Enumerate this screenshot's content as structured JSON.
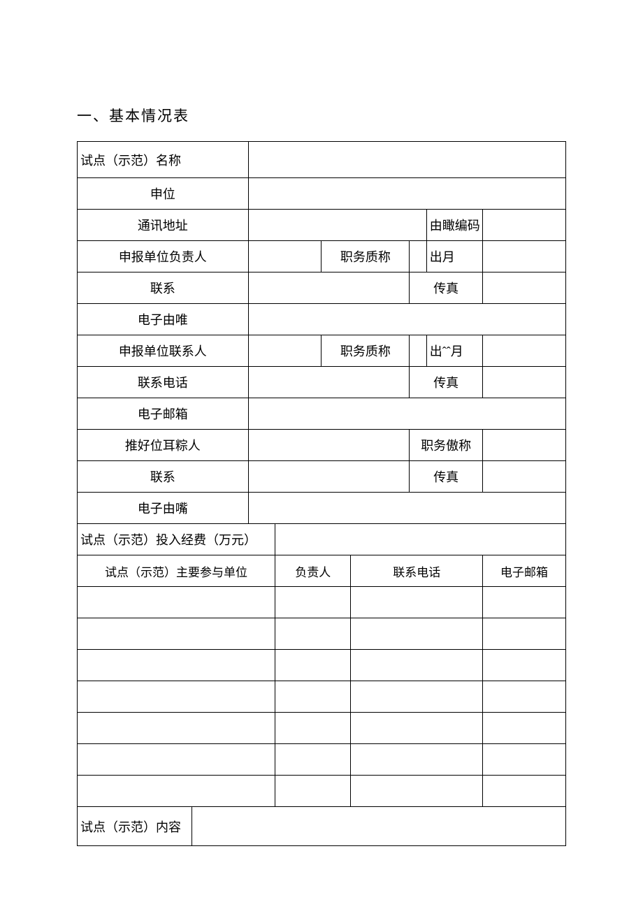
{
  "heading": "一、基本情况表",
  "rows": {
    "r1": {
      "c1": "试点（示范）名称"
    },
    "r2": {
      "c1": "申位"
    },
    "r3": {
      "c1": "通讯地址",
      "c3": "由瞰编码"
    },
    "r4": {
      "c1": "申报单位负责人",
      "c3": "职务质称",
      "c5": "出月"
    },
    "r5": {
      "c1": "联系",
      "c3": "传真"
    },
    "r6": {
      "c1": "电子由唯"
    },
    "r7": {
      "c1": "申报单位联系人",
      "c3": "职务质称",
      "c5": "出ˆˆ月"
    },
    "r8": {
      "c1": "联系电话",
      "c3": "传真"
    },
    "r9": {
      "c1": "电子邮箱"
    },
    "r10": {
      "c1": "推好位耳粽人",
      "c3": "职务傲称"
    },
    "r11": {
      "c1": "联系",
      "c3": "传真"
    },
    "r12": {
      "c1": "电子由嘴"
    },
    "r13": {
      "c1": "试点（示范）投入经费（万元）"
    },
    "r14": {
      "c1": "试点（示范）主要参与单位",
      "c2": "负责人",
      "c3": "联系电话",
      "c4": "电子邮箱"
    },
    "last": {
      "c1": "试点（示范）内容"
    }
  }
}
